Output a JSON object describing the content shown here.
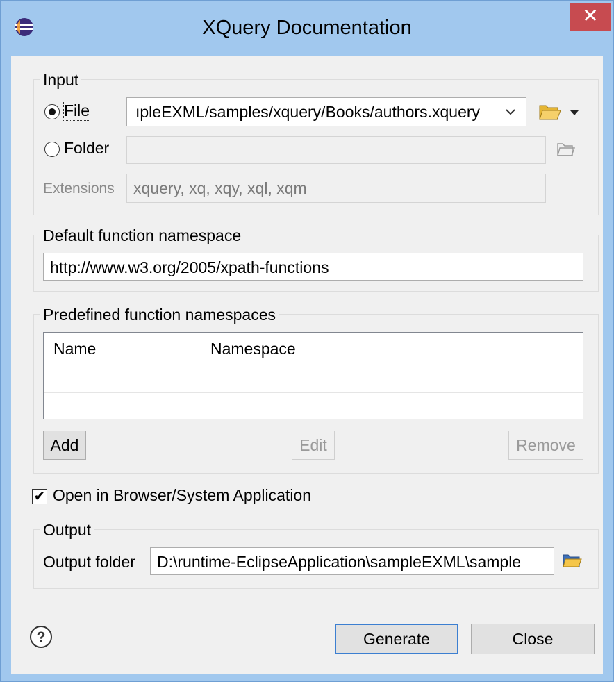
{
  "window": {
    "title": "XQuery Documentation",
    "close_glyph": "✕"
  },
  "input": {
    "group_label": "Input",
    "file_label": "File",
    "file_value": "ıpleEXML/samples/xquery/Books/authors.xquery",
    "folder_label": "Folder",
    "folder_value": "",
    "extensions_label": "Extensions",
    "extensions_value": "xquery, xq, xqy, xql, xqm"
  },
  "default_ns": {
    "group_label": "Default function namespace",
    "value": "http://www.w3.org/2005/xpath-functions"
  },
  "predefined_ns": {
    "group_label": "Predefined function namespaces",
    "columns": [
      "Name",
      "Namespace"
    ],
    "add_label": "Add",
    "edit_label": "Edit",
    "remove_label": "Remove"
  },
  "open_in_browser": {
    "label": "Open in Browser/System Application",
    "checked": true
  },
  "output": {
    "group_label": "Output",
    "folder_label": "Output folder",
    "folder_value": "D:\\runtime-EclipseApplication\\sampleEXML\\sample"
  },
  "footer": {
    "generate_label": "Generate",
    "close_label": "Close"
  },
  "icons": [
    "eclipse-icon",
    "folder-icon",
    "dropdown-arrow-icon",
    "help-icon",
    "check-icon"
  ]
}
